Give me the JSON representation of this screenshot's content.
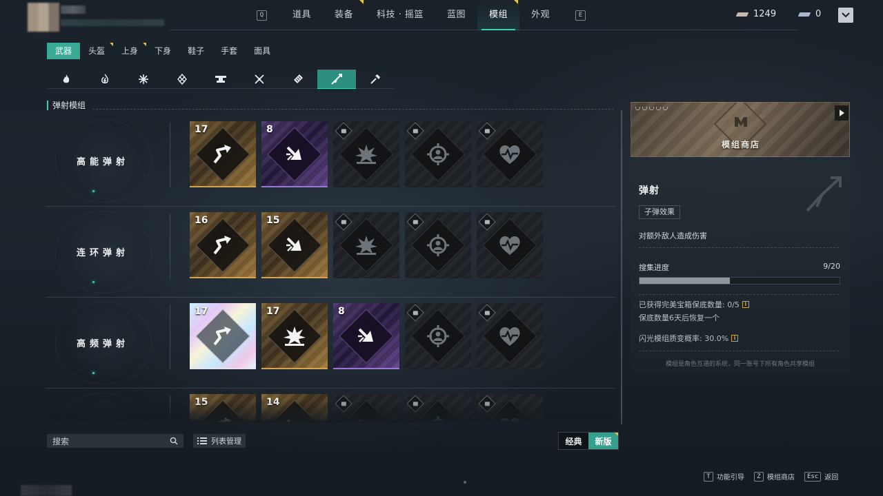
{
  "top_nav": {
    "prev_key": "Q",
    "next_key": "E",
    "tabs": [
      {
        "label": "道具",
        "active": false,
        "marked": false
      },
      {
        "label": "装备",
        "active": false,
        "marked": true
      },
      {
        "label": "科技 · 摇篮",
        "active": false,
        "marked": false
      },
      {
        "label": "蓝图",
        "active": false,
        "marked": false
      },
      {
        "label": "模组",
        "active": true,
        "marked": true
      },
      {
        "label": "外观",
        "active": false,
        "marked": false
      }
    ]
  },
  "currencies": [
    {
      "icon": "ticket-icon",
      "value": "1249"
    },
    {
      "icon": "blue-ticket-icon",
      "value": "0"
    }
  ],
  "sub_tabs": [
    {
      "label": "武器",
      "active": true,
      "marked": false
    },
    {
      "label": "头盔",
      "active": false,
      "marked": true
    },
    {
      "label": "上身",
      "active": false,
      "marked": true
    },
    {
      "label": "下身",
      "active": false,
      "marked": false
    },
    {
      "label": "鞋子",
      "active": false,
      "marked": false
    },
    {
      "label": "手套",
      "active": false,
      "marked": false
    },
    {
      "label": "面具",
      "active": false,
      "marked": false
    }
  ],
  "icon_tabs": [
    {
      "icon": "flame-icon",
      "active": false
    },
    {
      "icon": "lightning-flame-icon",
      "active": false
    },
    {
      "icon": "snowflake-icon",
      "active": false
    },
    {
      "icon": "shield-cross-icon",
      "active": false
    },
    {
      "icon": "anvil-icon",
      "active": false
    },
    {
      "icon": "crossed-swords-icon",
      "active": false
    },
    {
      "icon": "bullet-stack-icon",
      "active": false
    },
    {
      "icon": "ricochet-icon",
      "active": true
    },
    {
      "icon": "hammer-icon",
      "active": false
    }
  ],
  "section_title": "弹射模组",
  "rows": [
    {
      "label": "高能弹射",
      "cards": [
        {
          "tier": "gold",
          "level": "17",
          "icon": "ricochet-arrow-icon"
        },
        {
          "tier": "purple",
          "level": "8",
          "icon": "impact-arrow-icon"
        },
        {
          "tier": "locked",
          "level": "",
          "icon": "explosion-icon"
        },
        {
          "tier": "locked",
          "level": "",
          "icon": "crosshair-person-icon"
        },
        {
          "tier": "locked",
          "level": "",
          "icon": "heartbeat-icon"
        }
      ]
    },
    {
      "label": "连环弹射",
      "cards": [
        {
          "tier": "gold",
          "level": "16",
          "icon": "ricochet-arrow-icon"
        },
        {
          "tier": "gold",
          "level": "15",
          "icon": "impact-arrow-icon"
        },
        {
          "tier": "locked",
          "level": "",
          "icon": "explosion-icon"
        },
        {
          "tier": "locked",
          "level": "",
          "icon": "crosshair-person-icon"
        },
        {
          "tier": "locked",
          "level": "",
          "icon": "heartbeat-icon"
        }
      ]
    },
    {
      "label": "高频弹射",
      "cards": [
        {
          "tier": "iris",
          "level": "17",
          "icon": "ricochet-arrow-icon"
        },
        {
          "tier": "gold",
          "level": "17",
          "icon": "explosion-icon"
        },
        {
          "tier": "purple",
          "level": "8",
          "icon": "impact-arrow-icon"
        },
        {
          "tier": "locked",
          "level": "",
          "icon": "crosshair-person-icon"
        },
        {
          "tier": "locked",
          "level": "",
          "icon": "heartbeat-icon"
        }
      ]
    },
    {
      "label": "",
      "cards": [
        {
          "tier": "gold",
          "level": "15",
          "icon": "ricochet-arrow-icon"
        },
        {
          "tier": "gold",
          "level": "14",
          "icon": "impact-arrow-icon"
        },
        {
          "tier": "locked",
          "level": "",
          "icon": "impact-arrow-icon"
        },
        {
          "tier": "locked",
          "level": "",
          "icon": "crosshair-person-icon"
        },
        {
          "tier": "locked",
          "level": "",
          "icon": "heartbeat-icon"
        }
      ]
    }
  ],
  "toolbar": {
    "search_placeholder": "搜索",
    "list_manage_label": "列表管理",
    "mode_classic": "经典",
    "mode_new": "新版"
  },
  "shop": {
    "label": "模组商店"
  },
  "detail": {
    "title": "弹射",
    "effect_tag": "子弹效果",
    "description": "对额外敌人造成伤害",
    "progress_label": "搜集进度",
    "progress_text": "9/20",
    "progress_fraction": 0.45,
    "perfect_chest_text": "已获得完美宝箱保底数量: 0/5",
    "recover_text": "保底数量6天后恢复一个",
    "flash_text": "闪光模组质变概率: 30.0%",
    "footnote": "模组是角色互通的系统，同一账号下所有角色共享模组"
  },
  "hints": [
    {
      "key": "T",
      "label": "功能引导"
    },
    {
      "key": "Z",
      "label": "模组商店"
    },
    {
      "key": "Esc",
      "label": "返回"
    }
  ],
  "colors": {
    "accent": "#3fd1b5",
    "gold_tier": "#d8a44d",
    "purple_tier": "#9c79d6",
    "marker": "#e3c44a"
  }
}
